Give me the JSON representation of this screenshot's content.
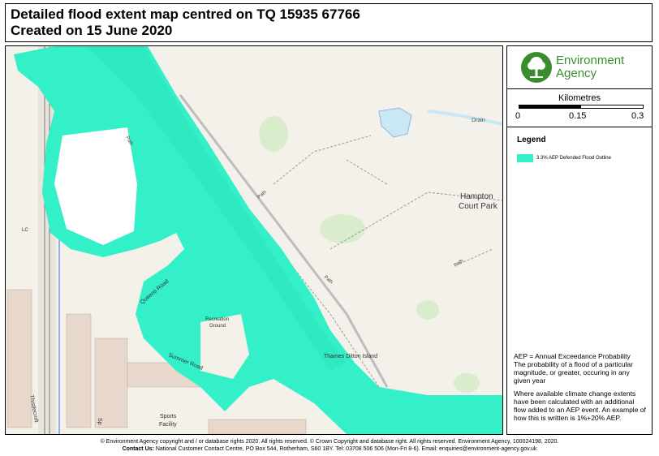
{
  "header": {
    "title_line1": "Detailed flood extent map centred on TQ 15935 67766",
    "title_line2": "Created on 15 June 2020"
  },
  "brand": {
    "logo_line1": "Environment",
    "logo_line2": "Agency",
    "logo_icon": "tree-logo-icon",
    "logo_color": "#3a8c2e"
  },
  "scale": {
    "title": "Kilometres",
    "labels": [
      "0",
      "0.15",
      "0.3"
    ]
  },
  "legend": {
    "title": "Legend",
    "items": [
      {
        "label": "3.3% AEP Defended Flood Outline",
        "color": "#33f0c8"
      }
    ]
  },
  "map": {
    "labels": {
      "hampton": "Hampton",
      "court_park": "Court Park",
      "drain": "Drain",
      "path1": "Path",
      "path2": "Path",
      "path3": "Path",
      "path4": "Path",
      "recreation": "Recreation",
      "ground": "Ground",
      "thames_ditton": "Thames Ditton Island",
      "sports": "Sports",
      "facility": "Facility",
      "summer_road": "Summer Road",
      "queens_road": "Queens Road",
      "thistlecroft": "Thistlecroft",
      "lc": "LC",
      "sp": "Sp"
    },
    "colors": {
      "flood": "#33f0c8",
      "water": "#c9e8f4",
      "land": "#f4f1ea",
      "wood": "#d9eccb"
    }
  },
  "notes": {
    "aep_definition": "AEP = Annual Exceedance Probability",
    "aep_explanation": "The probability of a flood of a particular magnitude, or greater, occuring in any given year",
    "climate_note": "Where available climate change extents have been calculated with an additional flow added to an AEP event. An example of how this is written is 1%+20% AEP."
  },
  "footer": {
    "line1": "© Environment Agency copyright and / or database rights 2020. All rights reserved. © Crown Copyright and database right. All rights reserved. Environment Agency, 100024198, 2020.",
    "contact_label": "Contact Us:",
    "contact_text": "National Customer Contact Centre, PO Box 544, Rotherham, S60 1BY. Tel: 03708 506 506 (Mon-Fri 8-6). Email: enquiries@environment-agency.gov.uk"
  }
}
